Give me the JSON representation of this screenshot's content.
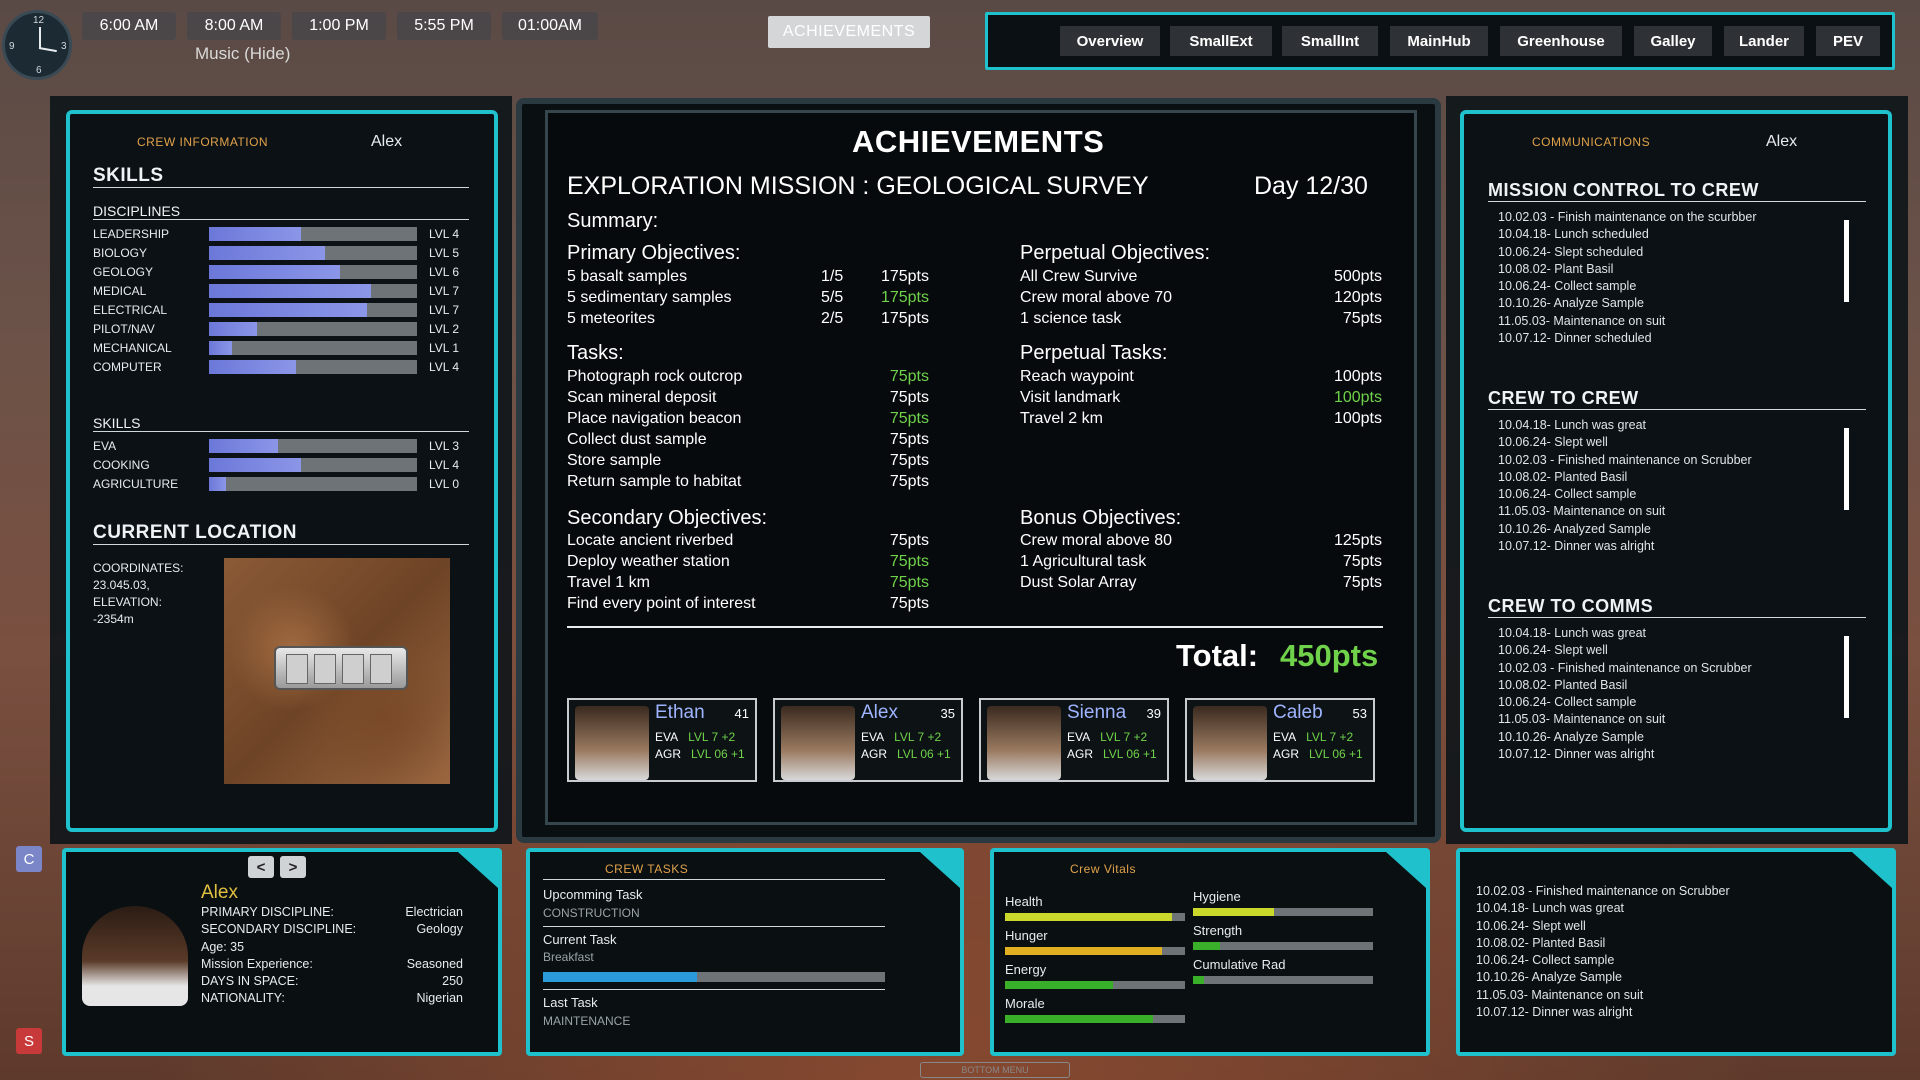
{
  "topbar": {
    "clock_numbers": [
      "12",
      "3",
      "6",
      "9"
    ],
    "times": [
      "6:00 AM",
      "8:00 AM",
      "1:00 PM",
      "5:55 PM",
      "01:00AM"
    ],
    "music": "Music (Hide)",
    "achievements_button": "ACHIEVEMENTS",
    "nav_tabs": [
      "Overview",
      "SmallExt",
      "SmallInt",
      "MainHub",
      "Greenhouse",
      "Galley",
      "Lander",
      "PEV"
    ]
  },
  "crew_info": {
    "header": "CREW INFORMATION",
    "name": "Alex",
    "skills_title": "SKILLS",
    "disciplines_title": "DISCIPLINES",
    "disciplines": [
      {
        "label": "LEADERSHIP",
        "level": "LVL 4",
        "fill": 0.44
      },
      {
        "label": "BIOLOGY",
        "level": "LVL 5",
        "fill": 0.56
      },
      {
        "label": "GEOLOGY",
        "level": "LVL 6",
        "fill": 0.63
      },
      {
        "label": "MEDICAL",
        "level": "LVL 7",
        "fill": 0.78
      },
      {
        "label": "ELECTRICAL",
        "level": "LVL 7",
        "fill": 0.76
      },
      {
        "label": "PILOT/NAV",
        "level": "LVL 2",
        "fill": 0.23
      },
      {
        "label": "MECHANICAL",
        "level": "LVL 1",
        "fill": 0.11
      },
      {
        "label": "COMPUTER",
        "level": "LVL 4",
        "fill": 0.42
      }
    ],
    "skills_sub": "SKILLS",
    "skills": [
      {
        "label": "EVA",
        "level": "LVL 3",
        "fill": 0.33
      },
      {
        "label": "COOKING",
        "level": "LVL 4",
        "fill": 0.44
      },
      {
        "label": "AGRICULTURE",
        "level": "LVL 0",
        "fill": 0.08
      }
    ],
    "location_title": "CURRENT LOCATION",
    "coord_label": "COORDINATES:",
    "coord_value": "23.045.03,",
    "elev_label": "ELEVATION:",
    "elev_value": "-2354m"
  },
  "achievements": {
    "title": "ACHIEVEMENTS",
    "mission": "EXPLORATION MISSION : GEOLOGICAL SURVEY",
    "day": "Day 12/30",
    "summary": "Summary:",
    "primary_title": "Primary Objectives:",
    "primary": [
      {
        "label": "5 basalt samples",
        "count": "1/5",
        "pts": "175pts",
        "green": false
      },
      {
        "label": "5 sedimentary samples",
        "count": "5/5",
        "pts": "175pts",
        "green": true
      },
      {
        "label": "5 meteorites",
        "count": "2/5",
        "pts": "175pts",
        "green": false
      }
    ],
    "tasks_title": "Tasks:",
    "tasks": [
      {
        "label": "Photograph rock outcrop",
        "pts": "75pts",
        "green": true
      },
      {
        "label": "Scan mineral deposit",
        "pts": "75pts",
        "green": false
      },
      {
        "label": "Place navigation beacon",
        "pts": "75pts",
        "green": true
      },
      {
        "label": "Collect dust sample",
        "pts": "75pts",
        "green": false
      },
      {
        "label": "Store sample",
        "pts": "75pts",
        "green": false
      },
      {
        "label": "Return sample to habitat",
        "pts": "75pts",
        "green": false
      }
    ],
    "secondary_title": "Secondary Objectives:",
    "secondary": [
      {
        "label": "Locate ancient riverbed",
        "pts": "75pts",
        "green": false
      },
      {
        "label": "Deploy weather station",
        "pts": "75pts",
        "green": true
      },
      {
        "label": "Travel 1 km",
        "pts": "75pts",
        "green": true
      },
      {
        "label": "Find every point of interest",
        "pts": "75pts",
        "green": false
      }
    ],
    "perpetual_obj_title": "Perpetual Objectives:",
    "perpetual_obj": [
      {
        "label": "All Crew Survive",
        "pts": "500pts",
        "green": false
      },
      {
        "label": "Crew moral above 70",
        "pts": "120pts",
        "green": false
      },
      {
        "label": "1 science task",
        "pts": "75pts",
        "green": false
      }
    ],
    "perpetual_tasks_title": "Perpetual Tasks:",
    "perpetual_tasks": [
      {
        "label": "Reach waypoint",
        "pts": "100pts",
        "green": false
      },
      {
        "label": "Visit landmark",
        "pts": "100pts",
        "green": true
      },
      {
        "label": "Travel 2 km",
        "pts": "100pts",
        "green": false
      }
    ],
    "bonus_title": "Bonus Objectives:",
    "bonus": [
      {
        "label": "Crew moral above 80",
        "pts": "125pts",
        "green": false
      },
      {
        "label": "1 Agricultural task",
        "pts": "75pts",
        "green": false
      },
      {
        "label": "Dust Solar Array",
        "pts": "75pts",
        "green": false
      }
    ],
    "total_label": "Total:",
    "total_value": "450pts",
    "crew": [
      {
        "name": "Ethan",
        "age": "41",
        "eva": "EVA",
        "eva_val": "LVL 7 +2",
        "agr": "AGR",
        "agr_val": "LVL 06 +1"
      },
      {
        "name": "Alex",
        "age": "35",
        "eva": "EVA",
        "eva_val": "LVL 7 +2",
        "agr": "AGR",
        "agr_val": "LVL 06 +1"
      },
      {
        "name": "Sienna",
        "age": "39",
        "eva": "EVA",
        "eva_val": "LVL 7 +2",
        "agr": "AGR",
        "agr_val": "LVL 06 +1"
      },
      {
        "name": "Caleb",
        "age": "53",
        "eva": "EVA",
        "eva_val": "LVL 7 +2",
        "agr": "AGR",
        "agr_val": "LVL 06 +1"
      }
    ]
  },
  "comms": {
    "header": "COMMUNICATIONS",
    "name": "Alex",
    "sections": [
      {
        "title": "MISSION CONTROL TO CREW",
        "messages": [
          "10.02.03 - Finish maintenance on the scurbber",
          "10.04.18- Lunch scheduled",
          "10.06.24- Slept scheduled",
          "10.08.02- Plant Basil",
          "10.06.24- Collect sample",
          "10.10.26- Analyze Sample",
          "11.05.03- Maintenance on suit",
          "10.07.12- Dinner scheduled"
        ]
      },
      {
        "title": "CREW TO CREW",
        "messages": [
          "10.04.18- Lunch was great",
          "10.06.24- Slept well",
          "10.02.03 - Finished maintenance on Scrubber",
          "10.08.02- Planted Basil",
          "10.06.24- Collect sample",
          "11.05.03- Maintenance on suit",
          "10.10.26- Analyzed Sample",
          "10.07.12- Dinner was alright"
        ]
      },
      {
        "title": "CREW TO COMMS",
        "messages": [
          "10.04.18- Lunch was great",
          "10.06.24- Slept well",
          "10.02.03 - Finished maintenance on Scrubber",
          "10.08.02- Planted Basil",
          "10.06.24- Collect sample",
          "11.05.03- Maintenance on suit",
          "10.10.26- Analyze Sample",
          "10.07.12- Dinner was alright"
        ]
      }
    ]
  },
  "profile": {
    "name": "Alex",
    "rows": [
      {
        "label": "PRIMARY DISCIPLINE:",
        "value": "Electrician"
      },
      {
        "label": "SECONDARY DISCIPLINE:",
        "value": "Geology"
      },
      {
        "label": "Age: 35",
        "value": ""
      },
      {
        "label": "Mission Experience:",
        "value": "Seasoned"
      },
      {
        "label": "DAYS IN SPACE:",
        "value": "250"
      },
      {
        "label": "NATIONALITY:",
        "value": "Nigerian"
      }
    ],
    "prev": "<",
    "next": ">"
  },
  "tasks": {
    "header": "CREW TASKS",
    "upcoming_label": "Upcomming Task",
    "upcoming_value": "CONSTRUCTION",
    "current_label": "Current Task",
    "current_value": "Breakfast",
    "current_progress": 0.45,
    "last_label": "Last Task",
    "last_value": "MAINTENANCE"
  },
  "vitals": {
    "header": "Crew Vitals",
    "left": [
      {
        "label": "Health",
        "fill": 0.93,
        "color": "#c9d82a"
      },
      {
        "label": "Hunger",
        "fill": 0.87,
        "color": "#e0b020"
      },
      {
        "label": "Energy",
        "fill": 0.6,
        "color": "#3ab02a"
      },
      {
        "label": "Morale",
        "fill": 0.82,
        "color": "#3ab02a"
      }
    ],
    "right": [
      {
        "label": "Hygiene",
        "fill": 0.45,
        "color": "#c9d82a"
      },
      {
        "label": "Strength",
        "fill": 0.15,
        "color": "#3ab02a"
      },
      {
        "label": "Cumulative Rad",
        "fill": 0.06,
        "color": "#3ab02a"
      }
    ]
  },
  "log": [
    "10.02.03 - Finished maintenance on Scrubber",
    "10.04.18- Lunch was great",
    "10.06.24- Slept well",
    "10.08.02- Planted Basil",
    "10.06.24- Collect sample",
    "10.10.26- Analyze Sample",
    "11.05.03- Maintenance on suit",
    "10.07.12- Dinner was alright"
  ],
  "side_buttons": {
    "c": "C",
    "s": "S"
  },
  "bottom_menu": "BOTTOM MENU"
}
